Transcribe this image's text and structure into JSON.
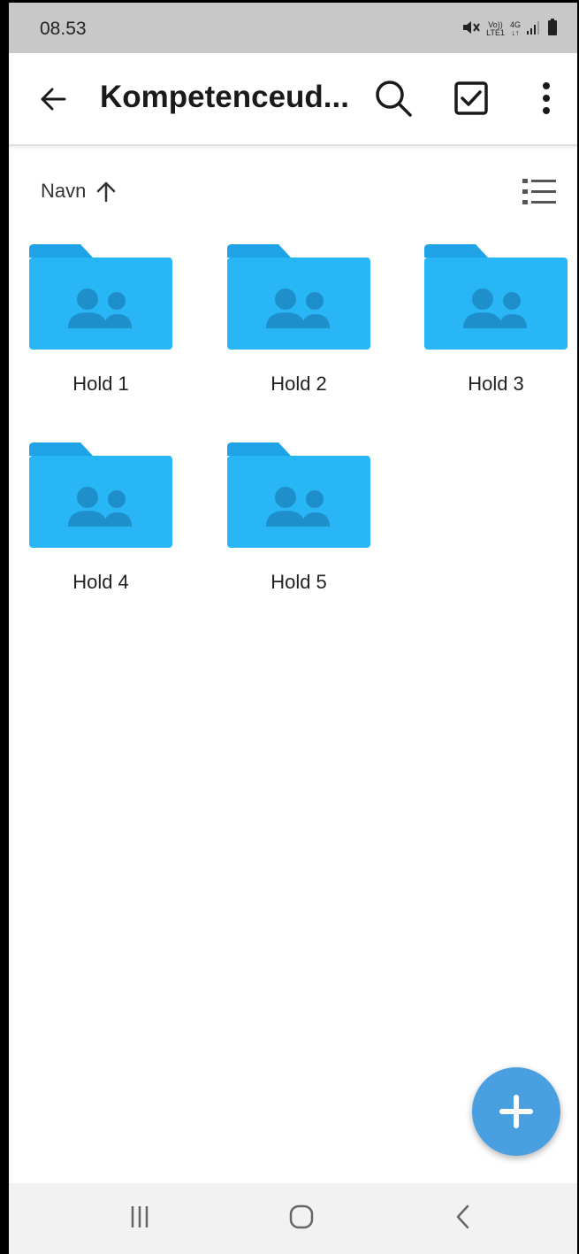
{
  "status_bar": {
    "time": "08.53",
    "network_top": "Vo))",
    "network_bottom": "LTE1",
    "network_type": "4G",
    "icons": [
      "mute-icon",
      "volte-icon",
      "4g-icon",
      "signal-icon",
      "battery-icon"
    ]
  },
  "app_bar": {
    "title": "Kompetenceud...",
    "icons": [
      "back-arrow-icon",
      "search-icon",
      "checkbox-icon",
      "more-vert-icon"
    ]
  },
  "sort": {
    "label": "Navn",
    "direction_icon": "arrow-up-icon",
    "view_icon": "list-view-icon"
  },
  "folders": [
    {
      "label": "Hold 1",
      "icon": "shared-folder-icon"
    },
    {
      "label": "Hold 2",
      "icon": "shared-folder-icon"
    },
    {
      "label": "Hold 3",
      "icon": "shared-folder-icon"
    },
    {
      "label": "Hold 4",
      "icon": "shared-folder-icon"
    },
    {
      "label": "Hold 5",
      "icon": "shared-folder-icon"
    }
  ],
  "fab": {
    "icon": "plus-icon"
  },
  "nav_bar": {
    "icons": [
      "recents-icon",
      "home-icon",
      "back-icon"
    ]
  },
  "colors": {
    "folder": "#29b6f6",
    "folder_tab": "#1fa3e6",
    "folder_glyph": "#1e8fcb",
    "fab": "#4a9fe0",
    "status_bar": "#c8c8c8",
    "nav_bar": "#f2f2f2"
  }
}
